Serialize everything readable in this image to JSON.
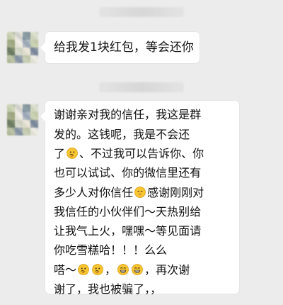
{
  "messages": [
    {
      "text": "给我发1块红包，等会还你"
    },
    {
      "lines": [
        "谢谢亲对我的信任，我这是群",
        "发的。这钱呢，我是不会还",
        "了🤔、不过我可以告诉你、你",
        "也可以试试、你的微信里还有",
        "多少人对你信任🤫感谢刚刚对",
        "我信任的小伙伴们～天热别给",
        "让我气上火，嘿嘿～等见面请",
        "你吃雪糕哈！！！么么",
        "嗒～🤔🤔，😁😁，再次谢",
        "谢了，我也被骗了，，"
      ]
    }
  ],
  "icons": {
    "thinking": "thinking-emoji-icon",
    "shush": "shushing-emoji-icon",
    "grin": "grinning-emoji-icon"
  }
}
